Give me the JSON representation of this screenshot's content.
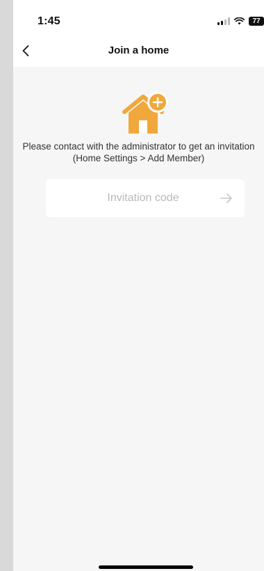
{
  "status_bar": {
    "time": "1:45",
    "battery": "77",
    "icons": [
      "cellular-signal-icon",
      "wifi-icon",
      "battery-icon"
    ]
  },
  "nav": {
    "title": "Join a home",
    "back_icon": "chevron-left-icon"
  },
  "illustration": {
    "icon": "house-add-icon",
    "color": "#F0A83C"
  },
  "instruction": "Please contact with the administrator to get an invitation (Home Settings > Add Member)",
  "invite": {
    "placeholder": "Invitation code",
    "value": "",
    "submit_icon": "arrow-right-icon"
  },
  "colors": {
    "accent": "#F0A83C",
    "background": "#F6F6F6",
    "surface": "#FFFFFF",
    "placeholder": "#B8B8B8"
  }
}
